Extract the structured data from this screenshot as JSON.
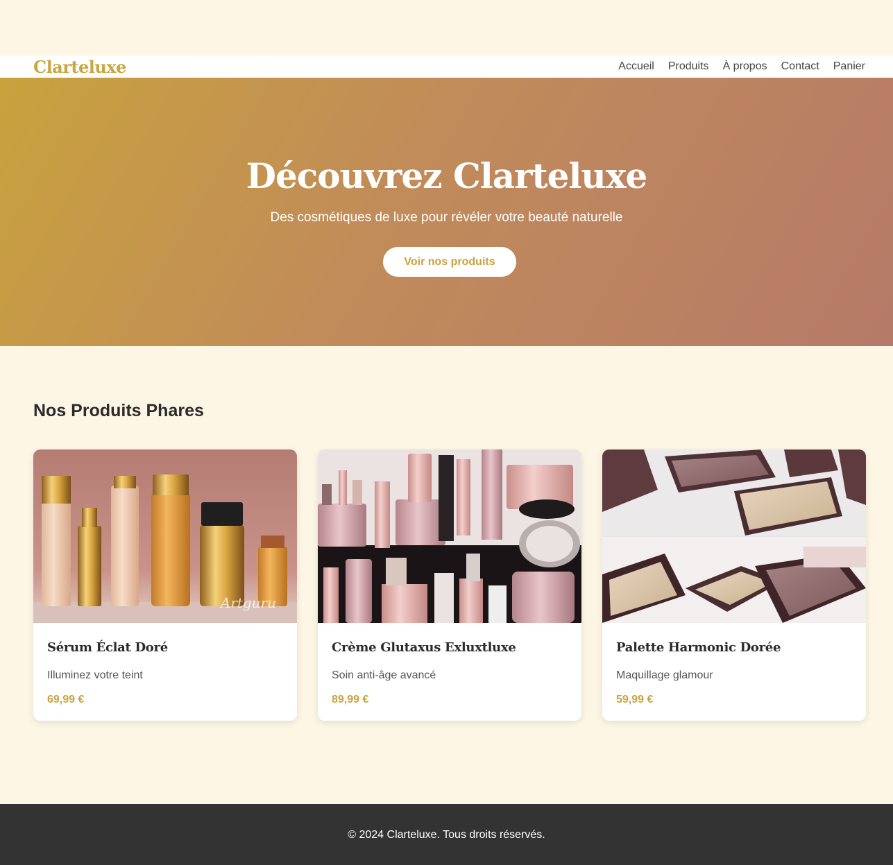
{
  "nav": {
    "logo": "Clarteluxe",
    "links": [
      "Accueil",
      "Produits",
      "À propos",
      "Contact",
      "Panier"
    ]
  },
  "hero": {
    "title": "Découvrez Clarteluxe",
    "subtitle": "Des cosmétiques de luxe pour révéler votre beauté naturelle",
    "button": "Voir nos produits"
  },
  "products_section": {
    "title": "Nos Produits Phares",
    "products": [
      {
        "name": "Sérum Éclat Doré",
        "description": "Illuminez votre teint",
        "price": "69,99 €",
        "image_watermark": "Artguru"
      },
      {
        "name": "Crème Glutaxus Exluxtluxe",
        "description": "Soin anti-âge avancé",
        "price": "89,99 €"
      },
      {
        "name": "Palette Harmonic Dorée",
        "description": "Maquillage glamour",
        "price": "59,99 €"
      }
    ]
  },
  "footer": {
    "text": "© 2024 Clarteluxe. Tous droits réservés."
  },
  "colors": {
    "accent": "#c9a23d",
    "background": "#fdf6e4",
    "footer": "#333333"
  }
}
